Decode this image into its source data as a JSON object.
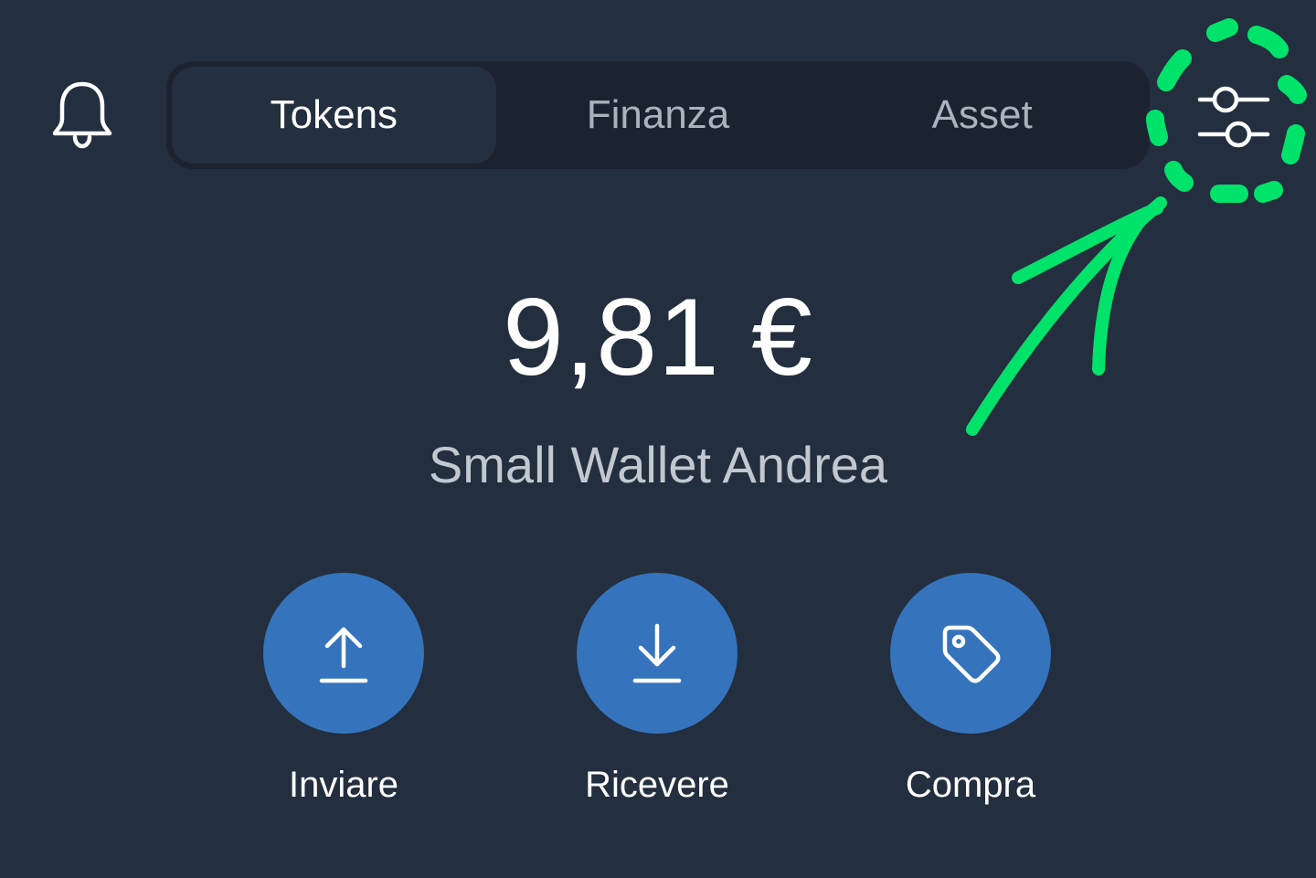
{
  "header": {
    "notifications_icon": "bell-icon",
    "filter_icon": "sliders-icon",
    "tabs": [
      {
        "label": "Tokens",
        "active": true
      },
      {
        "label": "Finanza",
        "active": false
      },
      {
        "label": "Asset",
        "active": false
      }
    ]
  },
  "wallet": {
    "balance": "9,81 €",
    "name": "Small Wallet Andrea"
  },
  "actions": [
    {
      "label": "Inviare",
      "icon": "upload-arrow-icon"
    },
    {
      "label": "Ricevere",
      "icon": "download-arrow-icon"
    },
    {
      "label": "Compra",
      "icon": "tag-icon"
    }
  ],
  "colors": {
    "background": "#232e3e",
    "tab_bar": "#1b2330",
    "action_button": "#3574bd",
    "annotation": "#00e36b"
  }
}
